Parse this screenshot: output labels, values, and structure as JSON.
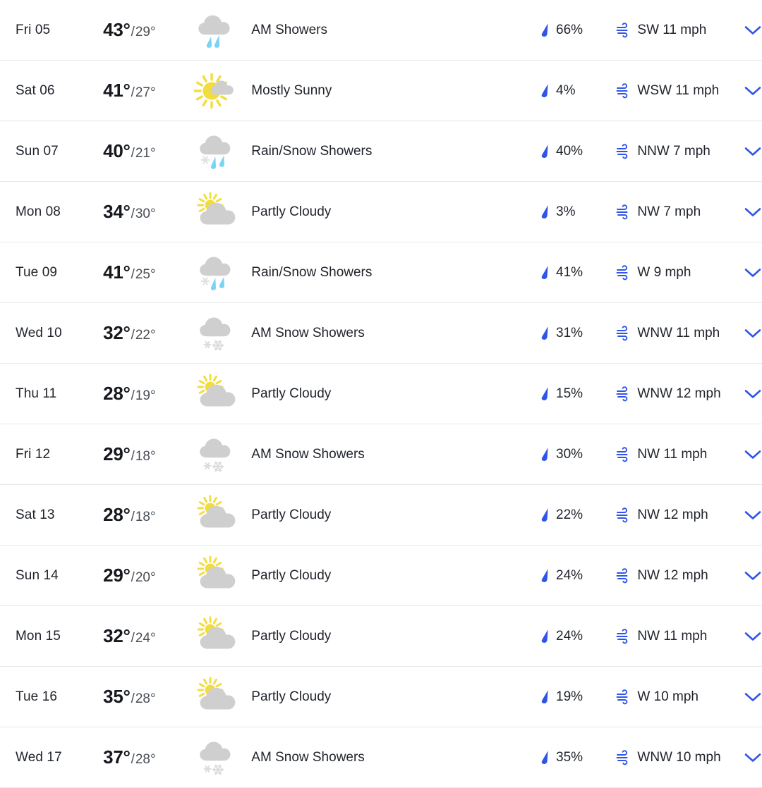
{
  "theme": {
    "accent_blue": "#2f55e8",
    "rain_blue": "#79d3f2",
    "cloud_gray": "#cfcfcf",
    "snow_gray": "#d8d8d8",
    "sun_yellow": "#f2dd3c",
    "text_dark": "#20242b",
    "divider": "#e6e8ea"
  },
  "icons": {
    "precipitation": "raindrop-icon",
    "wind": "wind-icon",
    "expand": "chevron-down-icon"
  },
  "units": {
    "degree": "°",
    "percent": "%",
    "speed": "mph",
    "separator": "/"
  },
  "forecast": {
    "rows": [
      {
        "day": "Fri 05",
        "high": "43°",
        "low": "29°",
        "condition": "AM Showers",
        "icon": "rain-showers-icon",
        "precip": "66%",
        "wind": "SW 11 mph"
      },
      {
        "day": "Sat 06",
        "high": "41°",
        "low": "27°",
        "condition": "Mostly Sunny",
        "icon": "mostly-sunny-icon",
        "precip": "4%",
        "wind": "WSW 11 mph"
      },
      {
        "day": "Sun 07",
        "high": "40°",
        "low": "21°",
        "condition": "Rain/Snow Showers",
        "icon": "rain-snow-showers-icon",
        "precip": "40%",
        "wind": "NNW 7 mph"
      },
      {
        "day": "Mon 08",
        "high": "34°",
        "low": "30°",
        "condition": "Partly Cloudy",
        "icon": "partly-cloudy-icon",
        "precip": "3%",
        "wind": "NW 7 mph"
      },
      {
        "day": "Tue 09",
        "high": "41°",
        "low": "25°",
        "condition": "Rain/Snow Showers",
        "icon": "rain-snow-showers-icon",
        "precip": "41%",
        "wind": "W 9 mph"
      },
      {
        "day": "Wed 10",
        "high": "32°",
        "low": "22°",
        "condition": "AM Snow Showers",
        "icon": "snow-showers-icon",
        "precip": "31%",
        "wind": "WNW 11 mph"
      },
      {
        "day": "Thu 11",
        "high": "28°",
        "low": "19°",
        "condition": "Partly Cloudy",
        "icon": "partly-cloudy-icon",
        "precip": "15%",
        "wind": "WNW 12 mph"
      },
      {
        "day": "Fri 12",
        "high": "29°",
        "low": "18°",
        "condition": "AM Snow Showers",
        "icon": "snow-showers-icon",
        "precip": "30%",
        "wind": "NW 11 mph"
      },
      {
        "day": "Sat 13",
        "high": "28°",
        "low": "18°",
        "condition": "Partly Cloudy",
        "icon": "partly-cloudy-icon",
        "precip": "22%",
        "wind": "NW 12 mph"
      },
      {
        "day": "Sun 14",
        "high": "29°",
        "low": "20°",
        "condition": "Partly Cloudy",
        "icon": "partly-cloudy-icon",
        "precip": "24%",
        "wind": "NW 12 mph"
      },
      {
        "day": "Mon 15",
        "high": "32°",
        "low": "24°",
        "condition": "Partly Cloudy",
        "icon": "partly-cloudy-icon",
        "precip": "24%",
        "wind": "NW 11 mph"
      },
      {
        "day": "Tue 16",
        "high": "35°",
        "low": "28°",
        "condition": "Partly Cloudy",
        "icon": "partly-cloudy-icon",
        "precip": "19%",
        "wind": "W 10 mph"
      },
      {
        "day": "Wed 17",
        "high": "37°",
        "low": "28°",
        "condition": "AM Snow Showers",
        "icon": "snow-showers-icon",
        "precip": "35%",
        "wind": "WNW 10 mph"
      }
    ]
  }
}
